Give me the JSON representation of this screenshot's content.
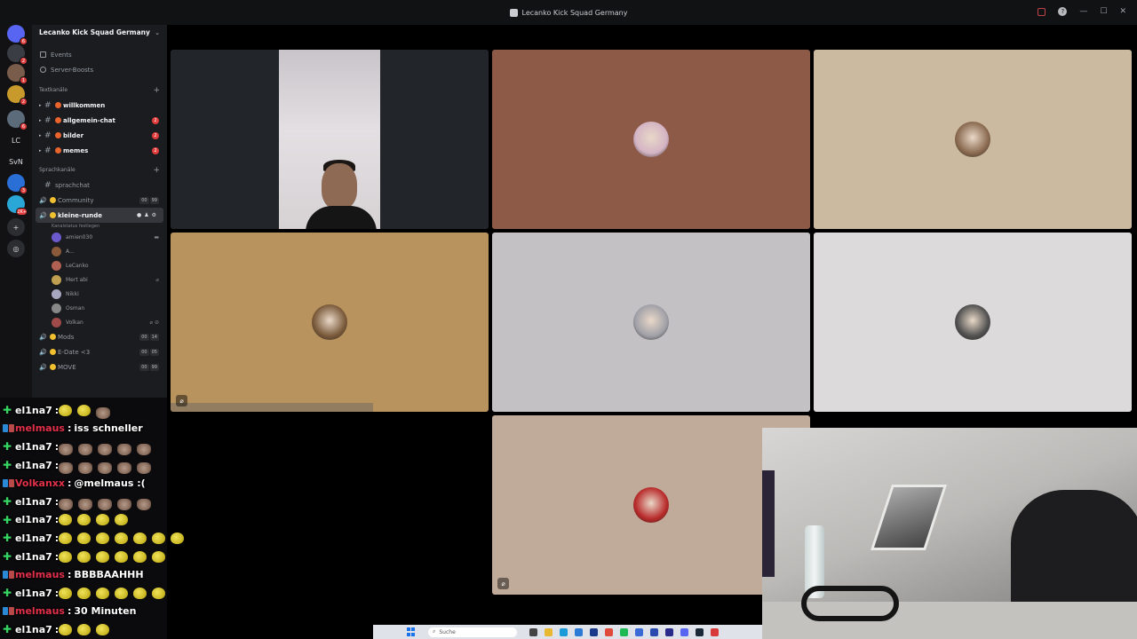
{
  "window": {
    "title": "Lecanko Kick Squad Germany"
  },
  "rail": {
    "servers": [
      {
        "label": "",
        "color": "#5865f2",
        "badge": "6"
      },
      {
        "label": "",
        "color": "#3a3d44",
        "badge": "2"
      },
      {
        "label": "",
        "color": "#7a5c4a",
        "badge": "1"
      },
      {
        "label": "",
        "color": "#c89a2c",
        "badge": "2"
      },
      {
        "label": "",
        "color": "#5c6b7a",
        "badge": "6"
      },
      {
        "label": "LC",
        "color": "transparent",
        "badge": ""
      },
      {
        "label": "SvN",
        "color": "transparent",
        "badge": ""
      },
      {
        "label": "",
        "color": "#2a6fd6",
        "badge": "3"
      },
      {
        "label": "",
        "color": "#2aa7d6",
        "badge": "2K+"
      }
    ]
  },
  "sidebar": {
    "guild_name": "Lecanko Kick Squad Germany",
    "links": [
      "Events",
      "Server-Boosts"
    ],
    "text_category": "Textkanäle",
    "text_channels": [
      {
        "name": "willkommen",
        "count": ""
      },
      {
        "name": "allgemein-chat",
        "count": "2"
      },
      {
        "name": "bilder",
        "count": "2"
      },
      {
        "name": "memes",
        "count": "2"
      }
    ],
    "voice_category": "Sprachkanäle",
    "text_channel_muted": "sprachchat",
    "voice_channels_top": [
      {
        "name": "Community",
        "c1": "00",
        "c2": "99"
      }
    ],
    "active_voice": {
      "name": "kleine-runde",
      "status": "Kanalstatus festlegen"
    },
    "members": [
      {
        "name": "amien030",
        "color": "#6a5acd"
      },
      {
        "name": "A...",
        "color": "#8a5a3a"
      },
      {
        "name": "LeCanko",
        "color": "#b06050"
      },
      {
        "name": "Mert abi",
        "color": "#c0a050"
      },
      {
        "name": "Nikki",
        "color": "#a7a7c0"
      },
      {
        "name": "Osman",
        "color": "#888888"
      },
      {
        "name": "Volkan",
        "color": "#a04a4a"
      }
    ],
    "voice_channels_bottom": [
      {
        "name": "Mods",
        "c1": "00",
        "c2": "14"
      },
      {
        "name": "E-Date <3",
        "c1": "00",
        "c2": "05"
      },
      {
        "name": "MOVE",
        "c1": "00",
        "c2": "99"
      }
    ]
  },
  "tiles": [
    {
      "bg": "#22262a",
      "avatar": "",
      "type": "camera"
    },
    {
      "bg": "#8e5a48",
      "avatar": "#d4b4c4"
    },
    {
      "bg": "#cbb9a0",
      "avatar": "#8a6a50"
    },
    {
      "bg": "#b9935e",
      "avatar": "#7a5a3a"
    },
    {
      "bg": "#c3c1c4",
      "avatar": "#a0a0a8"
    },
    {
      "bg": "#dddadc",
      "avatar": "#505050"
    },
    {
      "bg": "#c0aa9a",
      "avatar": "#b82a2a"
    }
  ],
  "chat": [
    {
      "user": "el1na7",
      "color": "#ffffff",
      "badge": "green",
      "emotes": [
        "frog",
        "frog",
        "cat"
      ],
      "text": ""
    },
    {
      "user": "melmaus",
      "color": "#e0304a",
      "badge": "blue",
      "emotes": [],
      "text": "iss schneller"
    },
    {
      "user": "el1na7",
      "color": "#ffffff",
      "badge": "green",
      "emotes": [
        "cat",
        "cat",
        "cat",
        "cat",
        "cat"
      ],
      "text": ""
    },
    {
      "user": "el1na7",
      "color": "#ffffff",
      "badge": "green",
      "emotes": [
        "cat",
        "cat",
        "cat",
        "cat",
        "cat"
      ],
      "text": ""
    },
    {
      "user": "Volkanxx",
      "color": "#e0304a",
      "badge": "blue",
      "emotes": [],
      "text": "@melmaus :("
    },
    {
      "user": "el1na7",
      "color": "#ffffff",
      "badge": "green",
      "emotes": [
        "cat",
        "cat",
        "cat",
        "cat",
        "cat"
      ],
      "text": ""
    },
    {
      "user": "el1na7",
      "color": "#ffffff",
      "badge": "green",
      "emotes": [
        "frog",
        "frog",
        "frog",
        "frog"
      ],
      "text": ""
    },
    {
      "user": "el1na7",
      "color": "#ffffff",
      "badge": "green",
      "emotes": [
        "frog",
        "frog",
        "frog",
        "frog",
        "frog",
        "frog",
        "frog"
      ],
      "text": ""
    },
    {
      "user": "el1na7",
      "color": "#ffffff",
      "badge": "green",
      "emotes": [
        "frog",
        "frog",
        "frog",
        "frog",
        "frog",
        "frog"
      ],
      "text": ""
    },
    {
      "user": "melmaus",
      "color": "#e0304a",
      "badge": "blue",
      "emotes": [],
      "text": "BBBBAAHHH"
    },
    {
      "user": "el1na7",
      "color": "#ffffff",
      "badge": "green",
      "emotes": [
        "frog",
        "frog",
        "frog",
        "frog",
        "frog",
        "frog"
      ],
      "text": ""
    },
    {
      "user": "melmaus",
      "color": "#e0304a",
      "badge": "blue",
      "emotes": [],
      "text": "30 Minuten"
    },
    {
      "user": "el1na7",
      "color": "#ffffff",
      "badge": "green",
      "emotes": [
        "frog",
        "frog",
        "frog"
      ],
      "text": ""
    }
  ],
  "taskbar": {
    "search_placeholder": "Suche"
  }
}
